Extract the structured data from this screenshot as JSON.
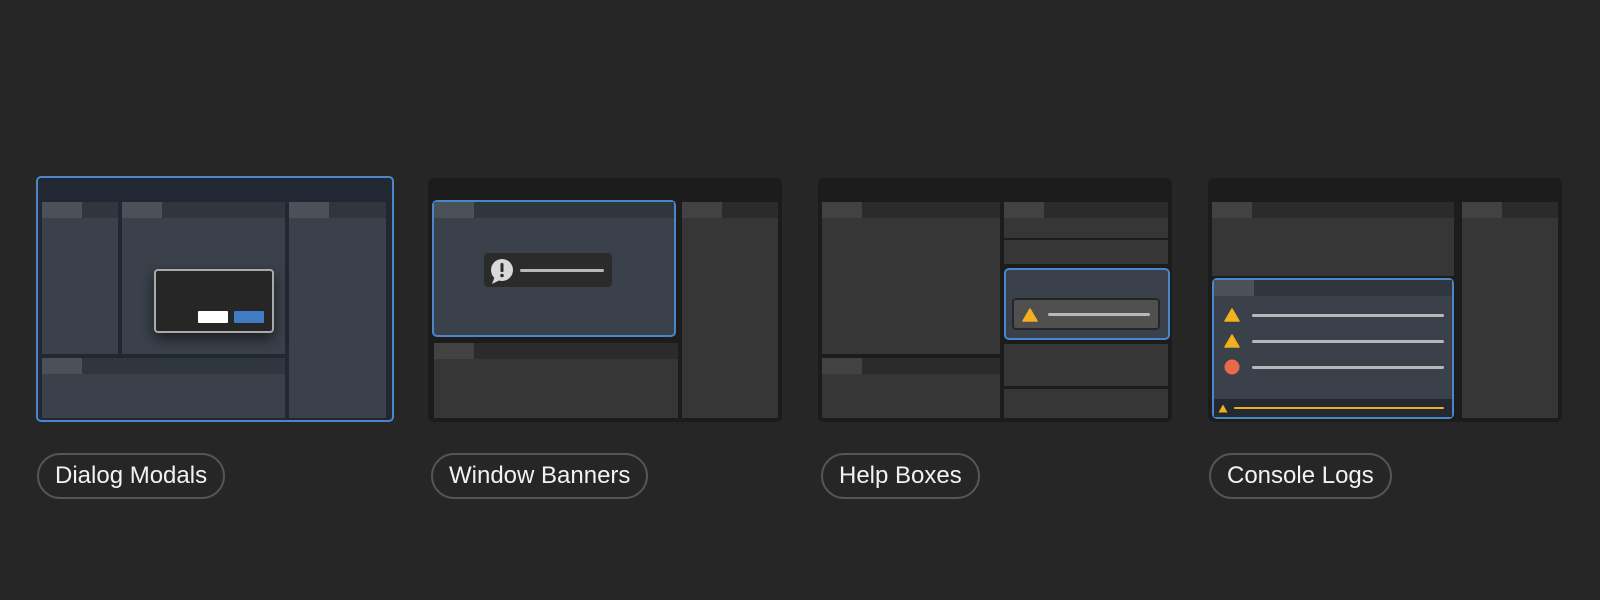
{
  "labels": {
    "dialog_modals": "Dialog Modals",
    "window_banners": "Window Banners",
    "help_boxes": "Help Boxes",
    "console_logs": "Console Logs"
  },
  "colors": {
    "background": "#262626",
    "accent": "#4a86c8",
    "warning": "#f2b01e",
    "error": "#e8694a"
  },
  "icons": [
    "exclamation-bubble-icon",
    "warning-triangle-icon",
    "error-circle-icon"
  ]
}
